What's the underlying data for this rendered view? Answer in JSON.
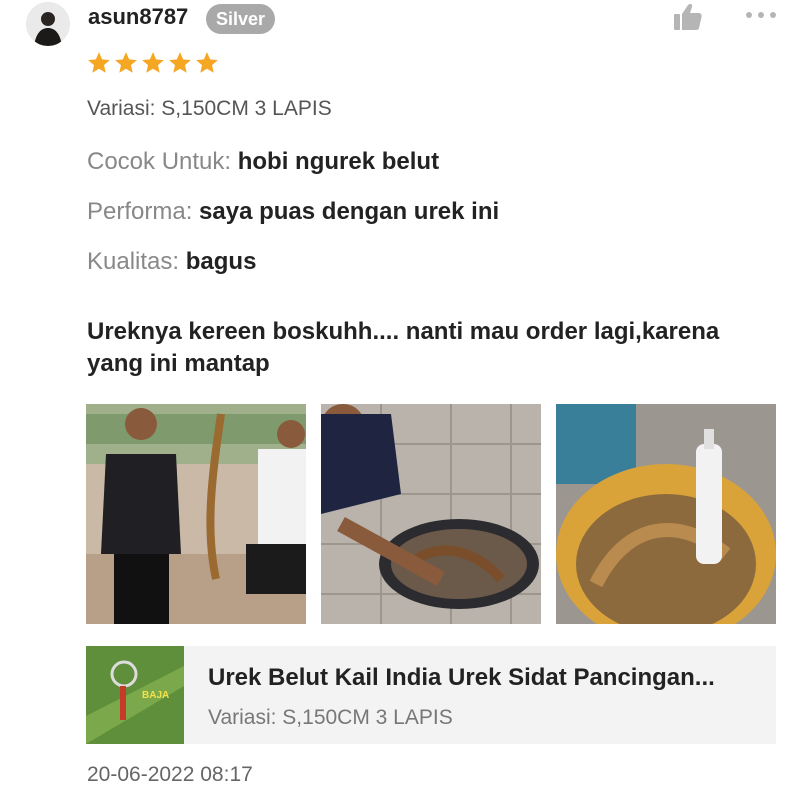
{
  "review": {
    "username": "asun8787",
    "badge": "Silver",
    "rating": 5,
    "rating_max": 5,
    "variation": "Variasi: S,150CM 3 LAPIS",
    "attributes": [
      {
        "key": "Cocok Untuk:",
        "value": "hobi ngurek belut"
      },
      {
        "key": "Performa:",
        "value": "saya puas dengan urek ini"
      },
      {
        "key": "Kualitas:",
        "value": "bagus"
      }
    ],
    "comment": "Ureknya kereen boskuhh.... nanti mau order lagi,karena yang ini mantap",
    "timestamp": "20-06-2022 08:17"
  },
  "product": {
    "title": "Urek Belut Kail India Urek Sidat Pancingan...",
    "variation": "Variasi: S,150CM 3 LAPIS",
    "thumb_text": "BAJA"
  },
  "icons": {
    "like": "thumbs-up-icon",
    "more": "more-options-icon",
    "star": "star-icon"
  },
  "colors": {
    "star": "#f5a623",
    "badge": "#a9a9a9",
    "product_bg": "#f3f3f3"
  }
}
